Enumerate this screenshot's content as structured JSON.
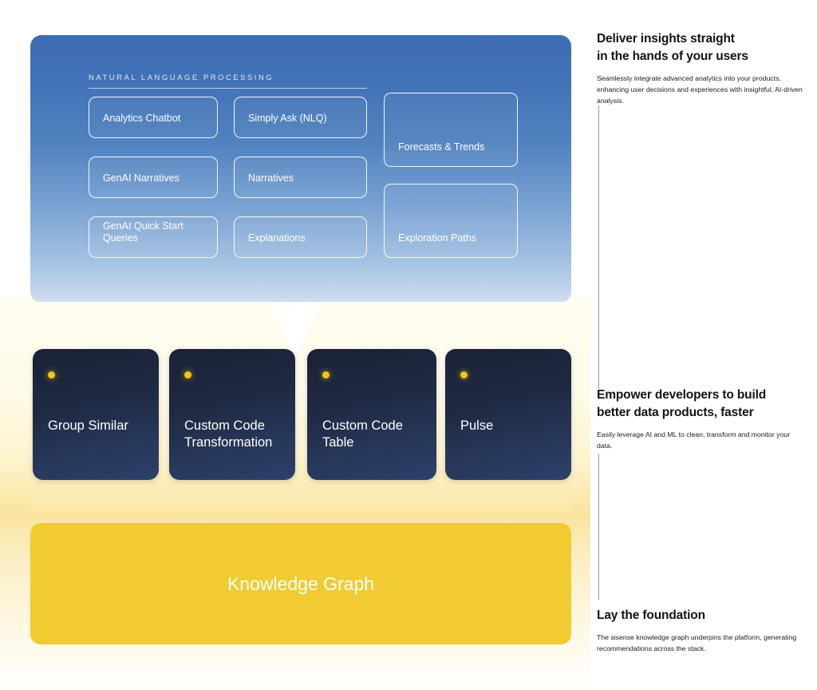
{
  "diagram": {
    "nlp_section": {
      "title": "NATURAL LANGUAGE PROCESSING",
      "cards": [
        {
          "label": "Analytics Chatbot"
        },
        {
          "label": "Simply Ask (NLQ)"
        },
        {
          "label": "Forecasts & Trends"
        },
        {
          "label": "GenAI Narratives"
        },
        {
          "label": "Narratives"
        },
        {
          "label": "Exploration Paths"
        },
        {
          "label": "GenAI Quick Start Queries"
        },
        {
          "label": "Explanations"
        }
      ]
    },
    "data_cards": [
      {
        "label": "Group Similar",
        "dot_color": "#f3c417"
      },
      {
        "label": "Custom Code Transformation",
        "dot_color": "#f3c417"
      },
      {
        "label": "Custom Code Table",
        "dot_color": "#f3c417"
      },
      {
        "label": "Pulse",
        "dot_color": "#f3c417"
      }
    ],
    "foundation": {
      "label": "Knowledge Graph"
    }
  },
  "sections": [
    {
      "heading_line1": "Deliver insights straight",
      "heading_line2": "in the hands of your users",
      "body": "Seamlessly integrate advanced analytics into your products, enhancing user decisions and experiences with insightful, AI-driven analysis."
    },
    {
      "heading_line1": "Empower developers to build",
      "heading_line2": "better data products, faster",
      "body": "Easily leverage AI and ML to clean, transform and monitor your data."
    },
    {
      "heading_line1": "Lay the foundation",
      "heading_line2": "",
      "body": "The sisense knowledge graph underpins the platform, generating recommendations across the stack."
    }
  ],
  "colors": {
    "blue_top": "#3d6cb3",
    "blue_bottom": "#cfdef0",
    "dark_card": "#1b2237",
    "accent_yellow": "#f3c417",
    "knowledge_graph": "#f0cb31",
    "cream": "#fefcf0"
  }
}
